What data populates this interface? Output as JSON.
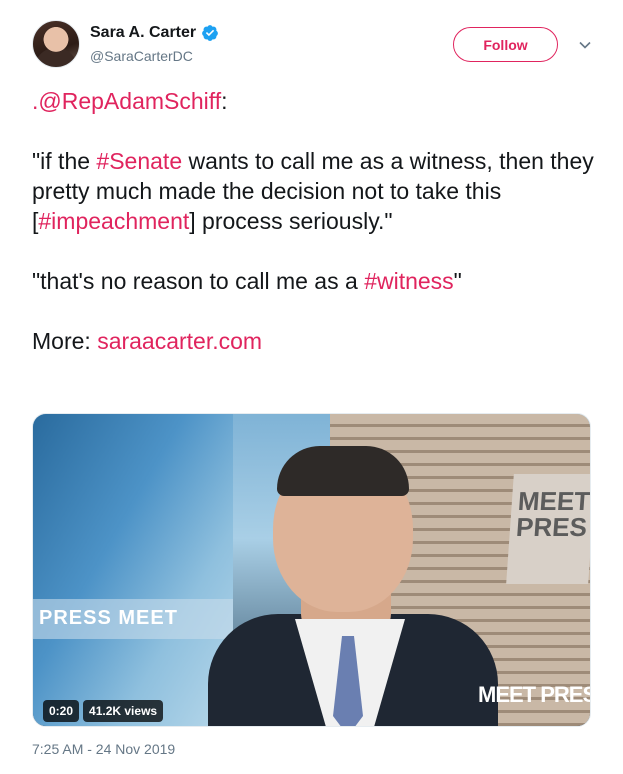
{
  "user": {
    "display_name": "Sara A. Carter",
    "handle": "@SaraCarterDC",
    "verified": true,
    "avatar_icon": "profile-photo"
  },
  "actions": {
    "follow_label": "Follow",
    "more_icon": "chevron-down-icon"
  },
  "tweet": {
    "mention": ".@RepAdamSchiff",
    "mention_suffix": ":",
    "quote1_a": "\"if the ",
    "hashtag_senate": "#Senate",
    "quote1_b": " wants to call me as a witness, then they pretty much made the decision not to take this [",
    "hashtag_impeachment": "#impeachment",
    "quote1_c": "] process seriously.\"",
    "quote2_a": "\"that's no reason to call me as a ",
    "hashtag_witness": "#witness",
    "quote2_b": "\"",
    "more_label": "More: ",
    "link": "saraacarter.com"
  },
  "media": {
    "duration": "0:20",
    "views": "41.2K views",
    "sign_press": "PRESS  MEET",
    "wall_logo_line1": "MEET",
    "wall_logo_line2": "PRES",
    "logo": "MEET PRESS"
  },
  "timestamp": "7:25 AM - 24 Nov 2019",
  "colors": {
    "accent": "#e0245e",
    "verified": "#1da1f2",
    "secondary_text": "#657786"
  }
}
